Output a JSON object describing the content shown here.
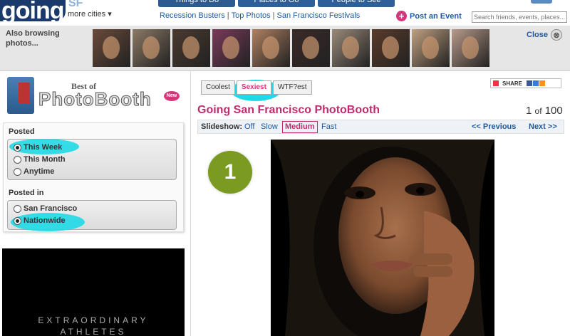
{
  "header": {
    "logo": "going",
    "city_code": "SF",
    "more_cities": "more cities ▾",
    "main_tabs": [
      "Things to Do",
      "Places to Go",
      "People to See"
    ],
    "subnav": [
      "Recession Busters",
      "Top Photos",
      "San Francisco Festivals"
    ],
    "post_event": "Post an Event",
    "search_placeholder": "Search friends, events, places..."
  },
  "strip": {
    "label": "Also browsing photos...",
    "thumbnail_count": 10,
    "close_label": "Close",
    "close_glyph": "⊗"
  },
  "sidebar": {
    "logo": {
      "best_of": "Best of",
      "title": "PhotoBooth",
      "badge": "New"
    },
    "posted": {
      "heading": "Posted",
      "options": [
        {
          "label": "This Week",
          "checked": true
        },
        {
          "label": "This Month",
          "checked": false
        },
        {
          "label": "Anytime",
          "checked": false
        }
      ]
    },
    "posted_in": {
      "heading": "Posted in",
      "options": [
        {
          "label": "San Francisco",
          "checked": false
        },
        {
          "label": "Nationwide",
          "checked": true
        }
      ]
    },
    "ad": {
      "line1": "EXTRAORDINARY",
      "line2": "ATHLETES"
    }
  },
  "main": {
    "tabs": [
      {
        "label": "Coolest",
        "active": false
      },
      {
        "label": "Sexiest",
        "active": true
      },
      {
        "label": "WTF?est",
        "active": false
      }
    ],
    "share_label": "SHARE",
    "title": "Going San Francisco PhotoBooth",
    "counter": {
      "current": "1",
      "of": "of",
      "total": "100"
    },
    "slideshow": {
      "label": "Slideshow:",
      "options": [
        "Off",
        "Slow",
        "Medium",
        "Fast"
      ],
      "active": "Medium",
      "previous": "<< Previous",
      "next": "Next >>"
    },
    "rank": "1"
  },
  "colors": {
    "brand_blue": "#1f5aa0",
    "accent_pink": "#c02d6e",
    "highlight_cyan": "#1ed9e6",
    "rank_green": "#7a9a22"
  }
}
